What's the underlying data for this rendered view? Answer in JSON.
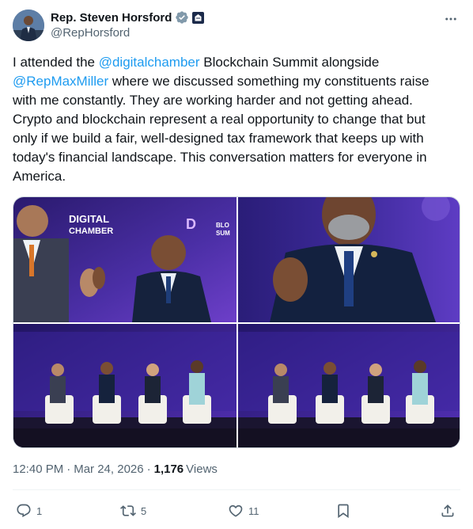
{
  "author": {
    "display_name": "Rep. Steven Horsford",
    "handle": "@RepHorsford"
  },
  "tweet": {
    "lines": [
      [
        {
          "text": "I attended the ",
          "mention": false
        },
        {
          "text": "@digitalchamber",
          "mention": true
        },
        {
          "text": " Blockchain Summit alongside",
          "mention": false
        }
      ],
      [
        {
          "text": "@RepMaxMiller",
          "mention": true
        },
        {
          "text": " where we discussed something my constituents raise",
          "mention": false
        }
      ],
      [
        {
          "text": "with me constantly. They are working harder and not getting ahead.",
          "mention": false
        }
      ],
      [
        {
          "text": "Crypto and blockchain represent a real opportunity to change that but",
          "mention": false
        }
      ],
      [
        {
          "text": "only if we build a fair, well-designed tax framework that keeps up with",
          "mention": false
        }
      ],
      [
        {
          "text": "today's financial landscape. This conversation matters for everyone in",
          "mention": false
        }
      ],
      [
        {
          "text": "America.",
          "mention": false
        }
      ]
    ]
  },
  "media": {
    "photo_text": {
      "brand_line1": "DIGITAL",
      "brand_line2": "CHAMBER",
      "summit_line1": "BLO",
      "summit_line2": "SUM"
    }
  },
  "meta": {
    "time": "12:40 PM",
    "separator": "·",
    "date": "Mar 24, 2026",
    "views_count": "1,176",
    "views_label": "Views"
  },
  "actions": {
    "replies": "1",
    "reposts": "5",
    "likes": "11"
  },
  "colors": {
    "accent": "#1d9bf0",
    "text_primary": "#0f1419",
    "text_secondary": "#536471",
    "stage_purple": "#4a2a9c"
  }
}
